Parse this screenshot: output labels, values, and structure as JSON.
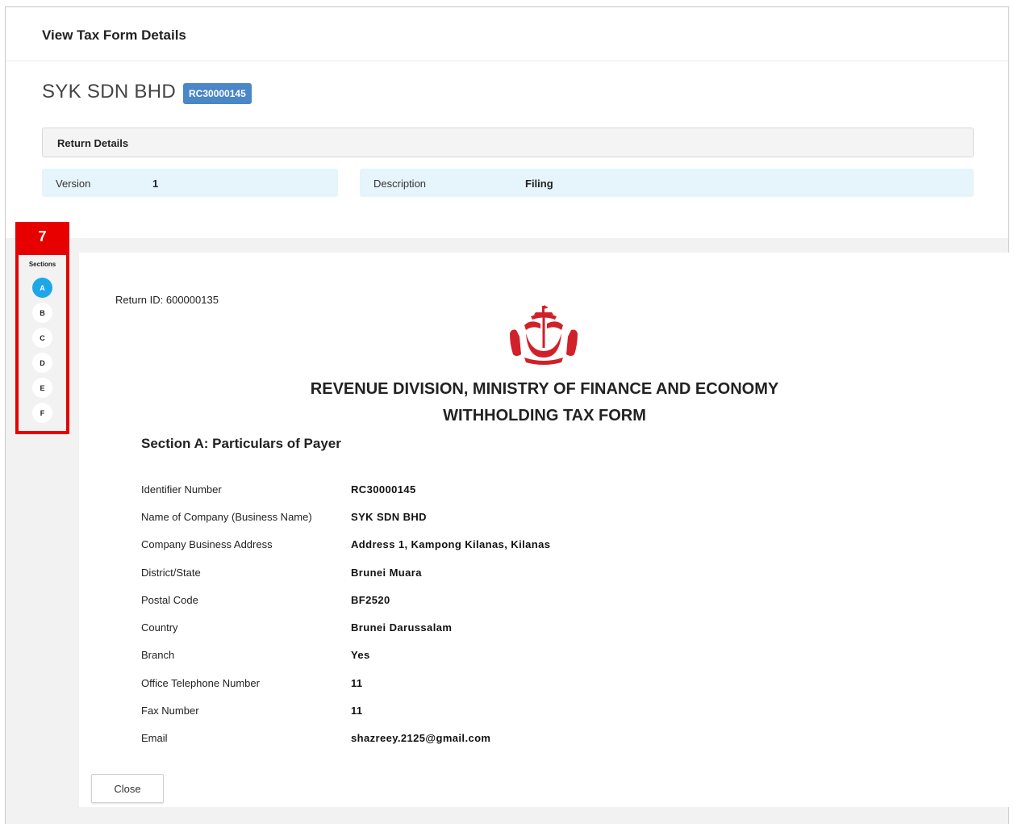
{
  "header": {
    "title": "View Tax Form Details"
  },
  "company": {
    "name": "SYK SDN BHD",
    "badge": "RC30000145"
  },
  "return_details": {
    "heading": "Return Details",
    "version_label": "Version",
    "version_value": "1",
    "description_label": "Description",
    "description_value": "Filing"
  },
  "callout": {
    "number": "7"
  },
  "sections": {
    "label": "Sections",
    "items": [
      "A",
      "B",
      "C",
      "D",
      "E",
      "F"
    ],
    "active": "A"
  },
  "form": {
    "return_id": "Return ID: 600000135",
    "org_title": "REVENUE DIVISION, MINISTRY OF FINANCE AND ECONOMY",
    "form_title": "WITHHOLDING TAX FORM",
    "section_heading": "Section A: Particulars of Payer",
    "fields": [
      {
        "label": "Identifier Number",
        "value": "RC30000145"
      },
      {
        "label": "Name of Company (Business Name)",
        "value": "SYK SDN BHD"
      },
      {
        "label": "Company Business Address",
        "value": "Address 1, Kampong Kilanas, Kilanas"
      },
      {
        "label": "District/State",
        "value": "Brunei Muara"
      },
      {
        "label": "Postal Code",
        "value": "BF2520"
      },
      {
        "label": "Country",
        "value": "Brunei Darussalam"
      },
      {
        "label": "Branch",
        "value": "Yes"
      },
      {
        "label": "Office Telephone Number",
        "value": "11"
      },
      {
        "label": "Fax Number",
        "value": "11"
      },
      {
        "label": "Email",
        "value": "shazreey.2125@gmail.com"
      }
    ]
  },
  "buttons": {
    "close": "Close"
  },
  "colors": {
    "badge": "#4a86c8",
    "active_section": "#1ea7e8",
    "callout": "#e60000",
    "info_box": "#e6f4fb",
    "emblem": "#d0202a"
  },
  "icons": {
    "emblem": "brunei-state-emblem-icon"
  }
}
